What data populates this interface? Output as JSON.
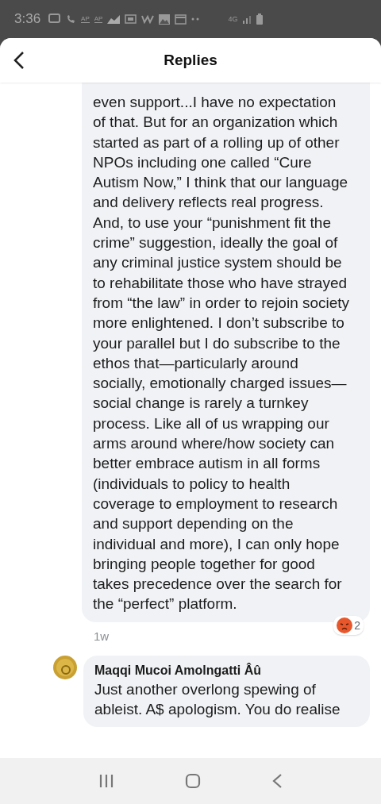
{
  "status_bar": {
    "time": "3:36",
    "badges": [
      "AP",
      "AP"
    ],
    "network": "4G"
  },
  "header": {
    "title": "Replies"
  },
  "comments": [
    {
      "kind": "continued",
      "body": "even support...I have no expectation of that.  But for an organization which started as part of a rolling up of other NPOs including one called “Cure Autism Now,” I think that our language and delivery reflects real progress. And, to use your “punishment fit the crime” suggestion, ideally the goal of any criminal justice system should be to rehabilitate those who have strayed from “the law” in order to rejoin society more enlightened.  I don’t subscribe to your parallel but I do subscribe to the ethos that—particularly around socially, emotionally charged issues—social change is rarely a turnkey process. Like all of us wrapping our arms around where/how society can better embrace autism in all forms (individuals to policy to health coverage to employment to research and support depending on the individual and more), I can only hope bringing people together for good takes precedence over the search for the “perfect” platform.",
      "time": "1w",
      "reaction_count": "2"
    },
    {
      "kind": "new",
      "author": "Maqqi Mucoi Amolngatti Âû",
      "body": "Just another overlong spewing of ableist. A$ apologism. You do realise"
    }
  ]
}
